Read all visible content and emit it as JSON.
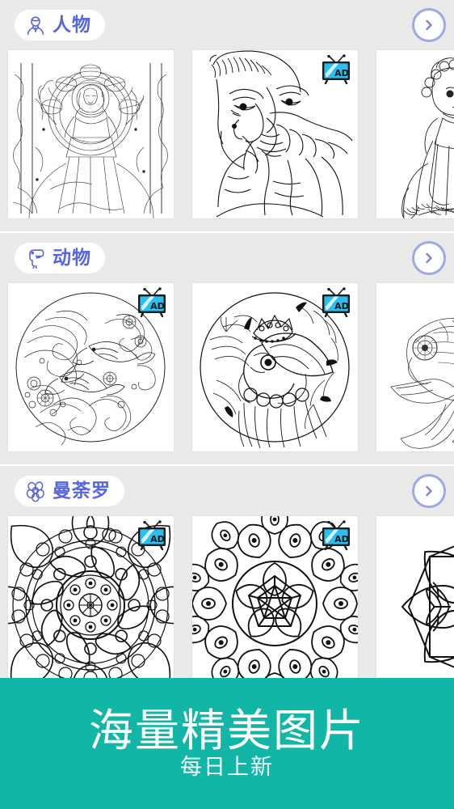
{
  "theme": {
    "page_background": "#ffffff",
    "section_background": "#eaeaea",
    "accent_blue": "#5665dd",
    "arrow_ring": "#9ea8e2",
    "banner_teal": "#12b6a6",
    "card_background": "#ffffff",
    "ad_badge_cyan": "#29c0f0"
  },
  "sections": [
    {
      "id": "people",
      "icon": "person-avatar-icon",
      "label": "人物",
      "arrow": "chevron-right-icon",
      "cards": [
        {
          "name": "coloring-page-goddess",
          "art": "goddess",
          "ad": false
        },
        {
          "name": "coloring-page-portrait",
          "art": "portrait",
          "ad": true
        },
        {
          "name": "coloring-page-princess",
          "art": "princess",
          "ad": false
        }
      ]
    },
    {
      "id": "animals",
      "icon": "toucan-bird-icon",
      "label": "动物",
      "arrow": "chevron-right-icon",
      "cards": [
        {
          "name": "coloring-page-fish-waves",
          "art": "fishwaves",
          "ad": true
        },
        {
          "name": "coloring-page-toucan",
          "art": "toucan",
          "ad": true
        },
        {
          "name": "coloring-page-goldfish",
          "art": "goldfish",
          "ad": false
        }
      ]
    },
    {
      "id": "mandala",
      "icon": "mandala-flower-icon",
      "label": "曼荼罗",
      "arrow": "chevron-right-icon",
      "cards": [
        {
          "name": "coloring-page-mandala-lotus",
          "art": "mandala1",
          "ad": true
        },
        {
          "name": "coloring-page-mandala-peacock",
          "art": "mandala2",
          "ad": true
        },
        {
          "name": "coloring-page-mandala-star",
          "art": "mandala3",
          "ad": false
        }
      ]
    }
  ],
  "ad_badge": {
    "label": "AD",
    "icon": "tv-ad-icon"
  },
  "banner": {
    "title": "海量精美图片",
    "subtitle": "每日上新"
  }
}
